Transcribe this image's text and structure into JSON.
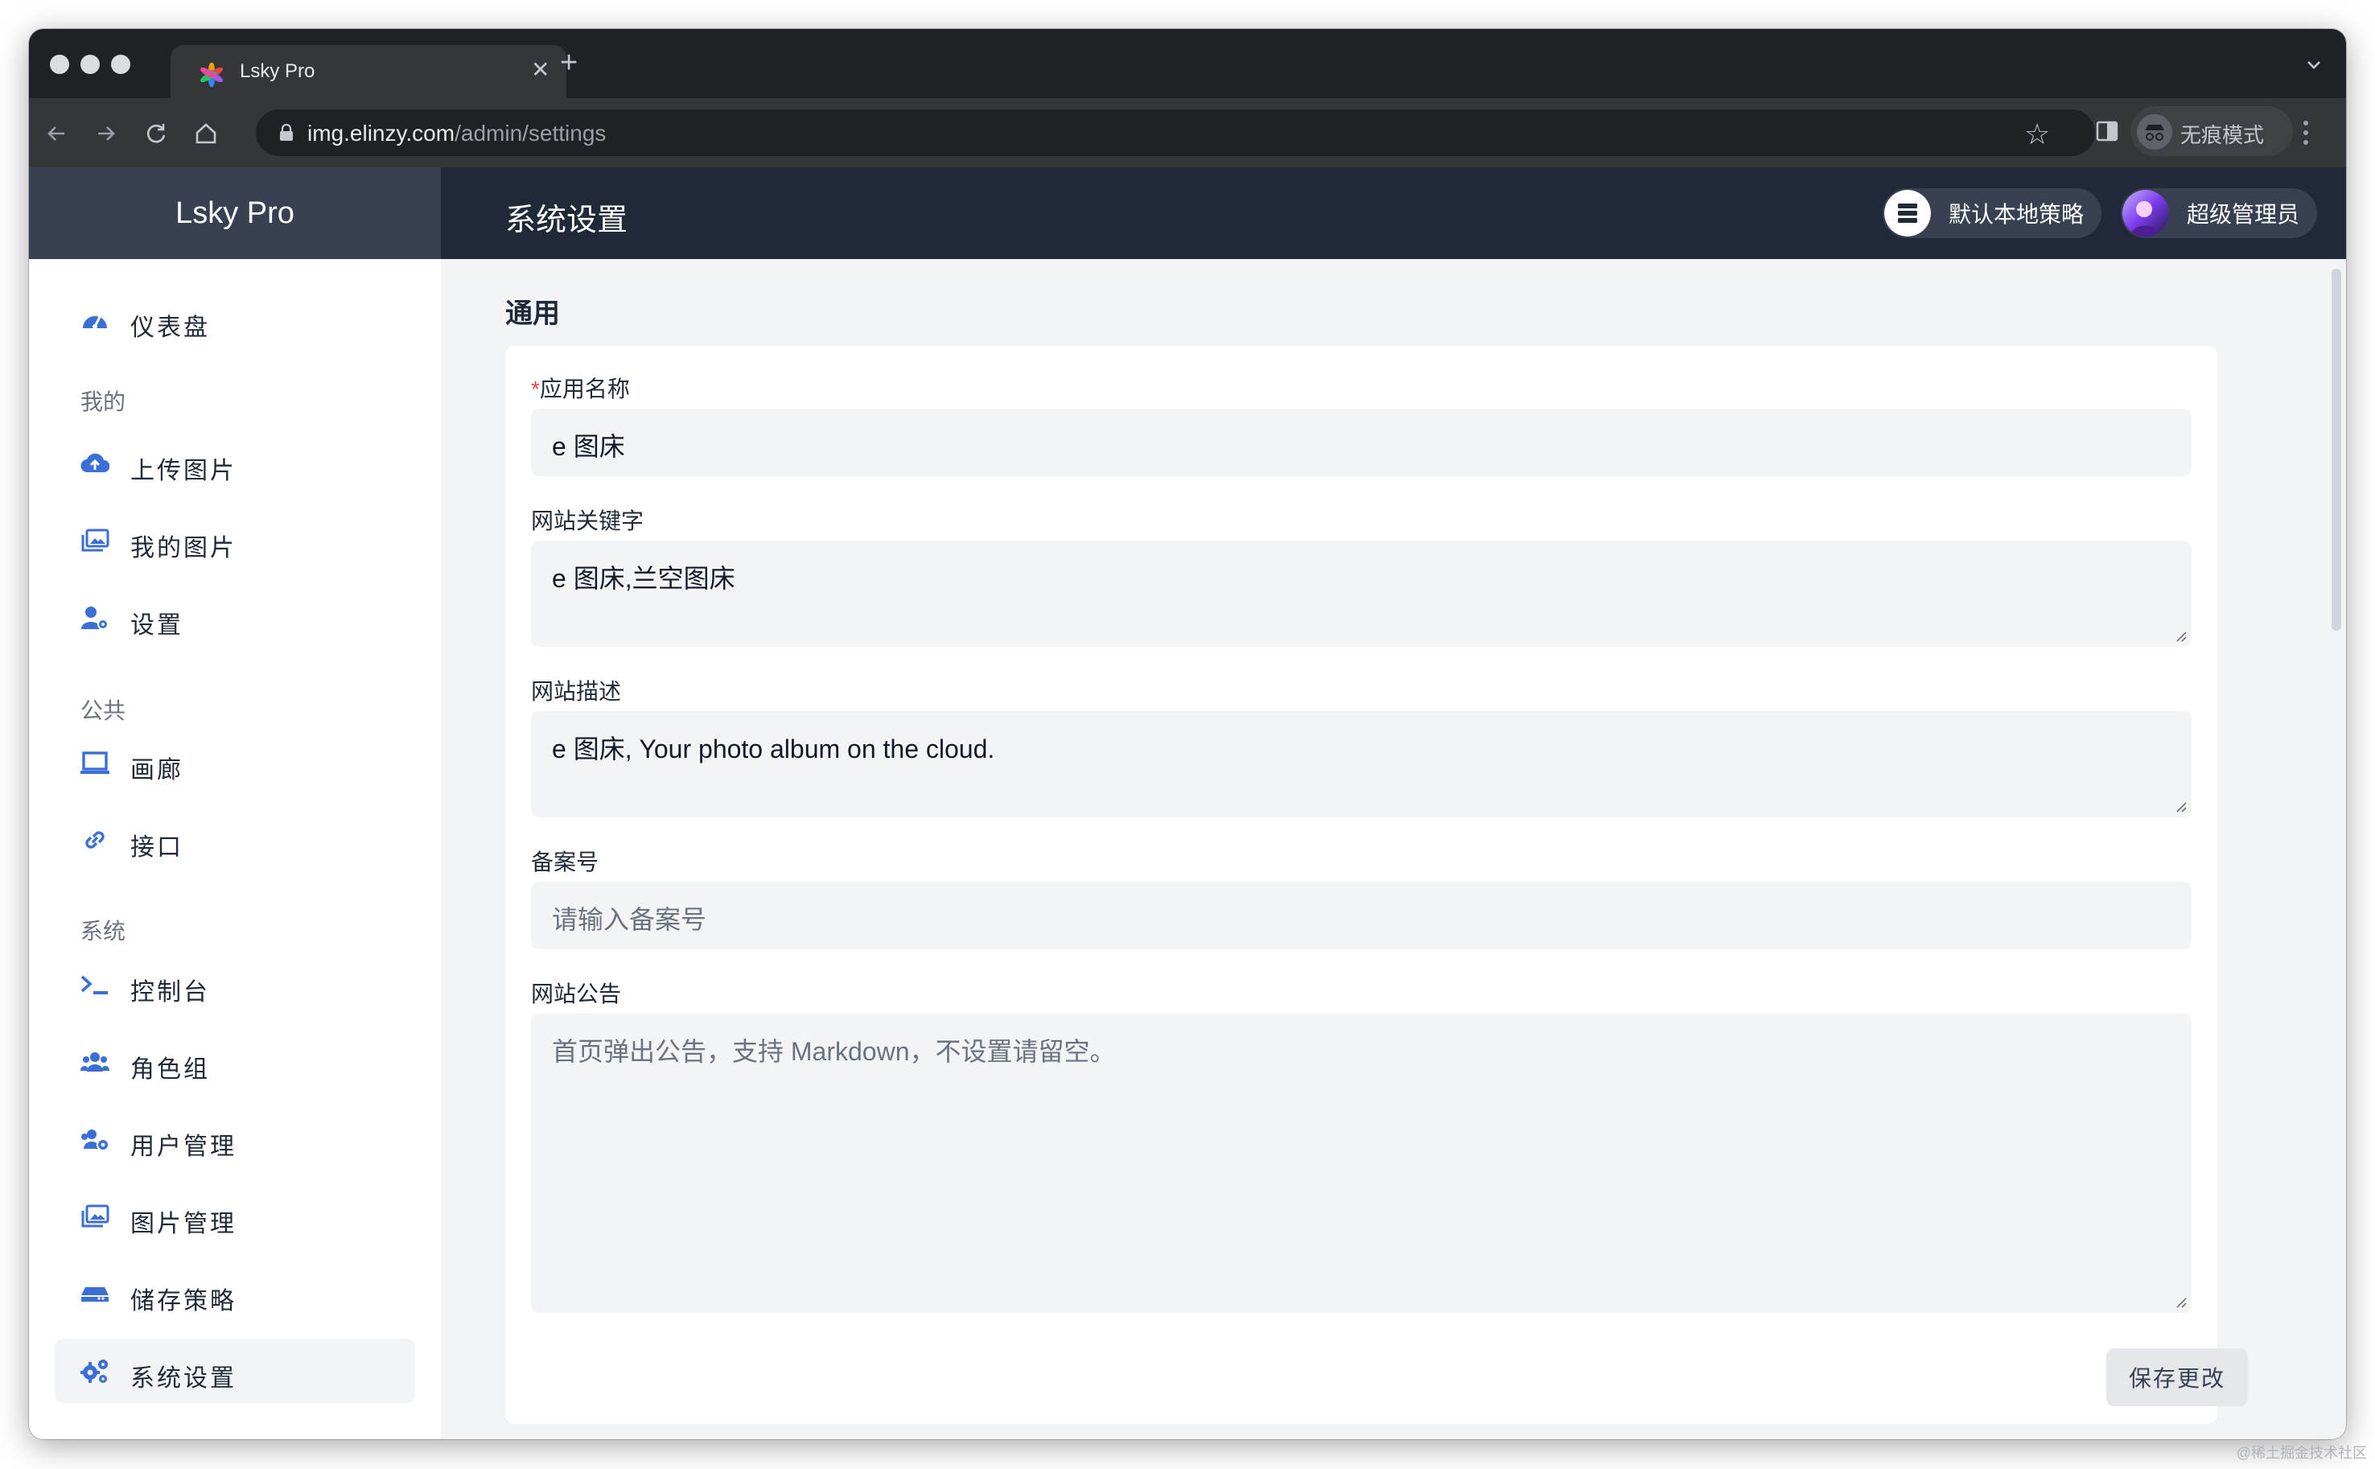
{
  "browser": {
    "tab_title": "Lsky Pro",
    "url_host": "img.elinzy.com",
    "url_path": "/admin/settings",
    "incognito_label": "无痕模式"
  },
  "app": {
    "brand": "Lsky Pro",
    "page_title": "系统设置",
    "strategy_label": "默认本地策略",
    "user_label": "超级管理员"
  },
  "sidebar": {
    "dashboard": "仪表盘",
    "section_mine": "我的",
    "upload": "上传图片",
    "my_images": "我的图片",
    "settings": "设置",
    "section_public": "公共",
    "gallery": "画廊",
    "api": "接口",
    "section_system": "系统",
    "console": "控制台",
    "roles": "角色组",
    "users": "用户管理",
    "images": "图片管理",
    "strategies": "储存策略",
    "system_settings": "系统设置"
  },
  "form": {
    "section_title": "通用",
    "app_name_required": "*",
    "app_name_label": "应用名称",
    "app_name_value": "e 图床",
    "keywords_label": "网站关键字",
    "keywords_value": "e 图床,兰空图床",
    "description_label": "网站描述",
    "description_value": "e 图床, Your photo album on the cloud.",
    "icp_label": "备案号",
    "icp_placeholder": "请输入备案号",
    "notice_label": "网站公告",
    "notice_placeholder": "首页弹出公告，支持 Markdown，不设置请留空。",
    "save_label": "保存更改"
  },
  "watermark": "@稀土掘金技术社区",
  "colors": {
    "accent": "#3b6fd8",
    "topbar": "#1f2937",
    "brand_bg": "#374151",
    "page_bg": "#f3f4f6",
    "required": "#ef4444"
  }
}
